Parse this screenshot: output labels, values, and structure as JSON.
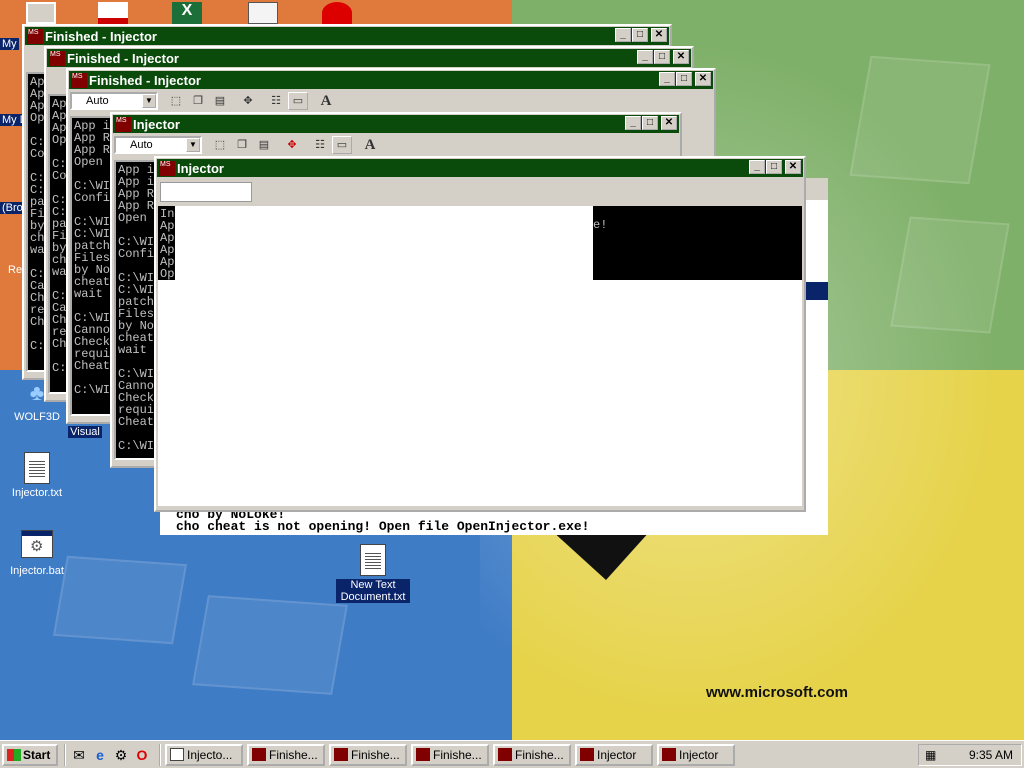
{
  "desktop": {
    "url": "www.microsoft.com",
    "left_labels": [
      "My",
      "My D",
      "(Bro",
      "Re"
    ],
    "icons": {
      "wolf3d": "WOLF3D",
      "visual": "Visual",
      "injector_txt": "Injector.txt",
      "injector_bat": "Injector.bat",
      "new_text": "New Text Document.txt"
    }
  },
  "windows": {
    "fin1_title": "Finished - Injector",
    "fin2_title": "Finished - Injector",
    "fin3_title": "Finished - Injector",
    "inj1_title": "Injector",
    "inj2_title": "Injector",
    "combo_value": "Auto",
    "w1_console": "Ap\nAp\nAp\nOp\n\nC:\nCo\n\nC:\nC:\npa\nFi\nby\nch\nwa\n\nC:\nCa\nCh\nre\nCh\n\nC:",
    "w2_console": "Ap\nAp\nAp\nOp\n\nC:\nCo\n\nC:\nC:\npa\nFi\nby\nch\nwa\n\nC:\nCa\nCh\nre\nCh\n\nC:",
    "w3_console": "App i\nApp R\nApp R\nOpen\n\nC:\\WI\nConfi\n\nC:\\WI\nC:\\WI\npatch\nFiles\nby No\ncheat\nwait\n\nC:\\WI\nCanno\nCheck\nrequi\nCheat\n\nC:\\WI",
    "w4_console": "App is\nApp is\nApp Re\nApp Re\nOpen t\n\nC:\\WIN\nConfig\n\nC:\\WI\nC:\\WI\npatch\nFiles\nby No\ncheat\nwait\n\nC:\\WI\nCanno\nCheck\nrequi\nCheat\n\nC:\\WI",
    "w5_console": "In\nAp\nAp\nAp\nAp\nOp",
    "behind_fragment": "e!",
    "bottom_line1": "cho by NoLoke!",
    "bottom_line2": "cho cheat is not opening! Open file OpenInjector.exe!"
  },
  "taskbar": {
    "start": "Start",
    "tasks": [
      "Injecto...",
      "Finishe...",
      "Finishe...",
      "Finishe...",
      "Finishe...",
      "Injector",
      "Injector"
    ],
    "clock": "9:35 AM"
  }
}
